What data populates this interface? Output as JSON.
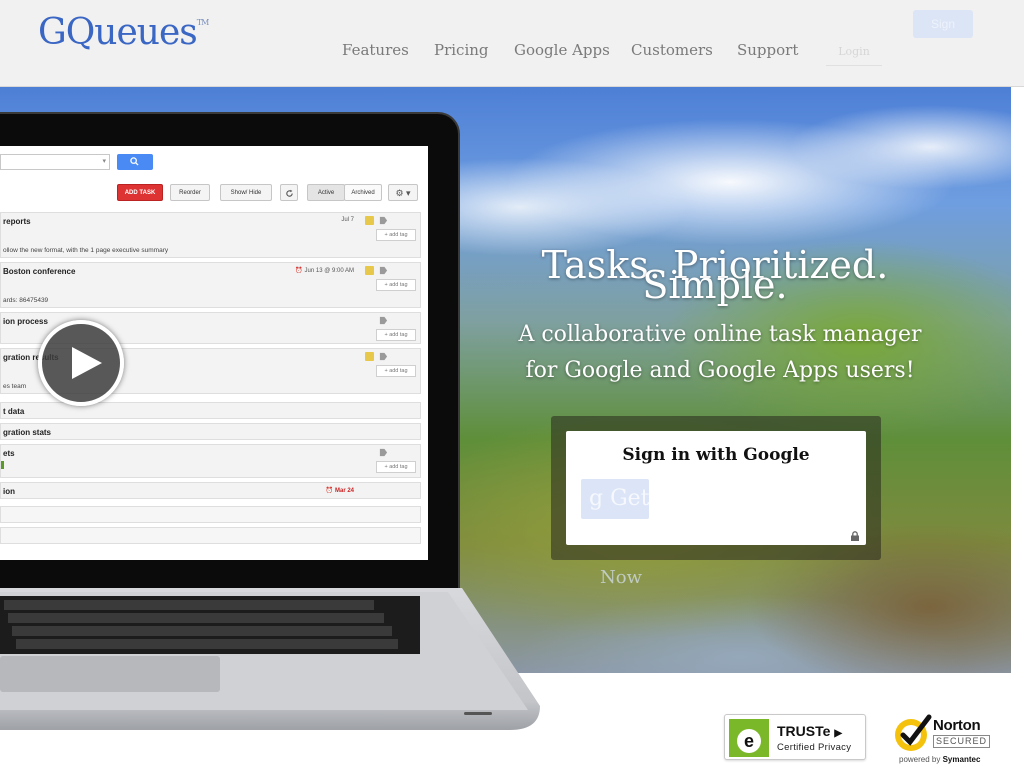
{
  "brand": {
    "name": "GQueues",
    "tm": "TM"
  },
  "nav": [
    {
      "label": "Features"
    },
    {
      "label": "Pricing"
    },
    {
      "label": "Google Apps"
    },
    {
      "label": "Customers"
    },
    {
      "label": "Support"
    }
  ],
  "header": {
    "signin_label": "Sign",
    "login_label": "Login"
  },
  "hero": {
    "title_line1": "Tasks. Prioritized.",
    "title_line2": "Simple.",
    "subtitle_line1": "A collaborative online task manager",
    "subtitle_line2": "for Google and Google Apps users!",
    "signin_title": "Sign in with Google",
    "google_button_label": "Get",
    "now_text": "Now"
  },
  "app": {
    "toolbar": {
      "add_task": "ADD TASK",
      "reorder": "Reorder",
      "show_hide": "Show/ Hide",
      "active": "Active",
      "archived": "Archived"
    },
    "add_tag_label": "+ add tag",
    "tasks": [
      {
        "title": "reports",
        "date": "Jul 7",
        "note": "ollow the new format, with the 1 page executive summary"
      },
      {
        "title": "Boston conference",
        "date": "Jun 13 @ 9:00 AM",
        "note": "ards: 86475439"
      },
      {
        "title": "ion process",
        "date": "",
        "note": ""
      },
      {
        "title": "gration results",
        "date": "",
        "note": "es team"
      },
      {
        "title": "t data",
        "date": "",
        "note": ""
      },
      {
        "title": "gration stats",
        "date": "",
        "note": ""
      },
      {
        "title": "ets",
        "date": "",
        "note": ""
      },
      {
        "title": "ion",
        "date": "Mar 24",
        "note": ""
      }
    ]
  },
  "badges": {
    "truste_name": "TRUSTe",
    "truste_sub": "Certified Privacy",
    "norton_name": "Norton",
    "norton_secured": "SECURED",
    "norton_powered_prefix": "powered by",
    "norton_powered_brand": "Symantec"
  },
  "colors": {
    "brand_blue": "#3a66c4",
    "nav_gray": "#7a7a7a",
    "add_task_red": "#dd3333",
    "search_blue": "#4a8af4"
  }
}
